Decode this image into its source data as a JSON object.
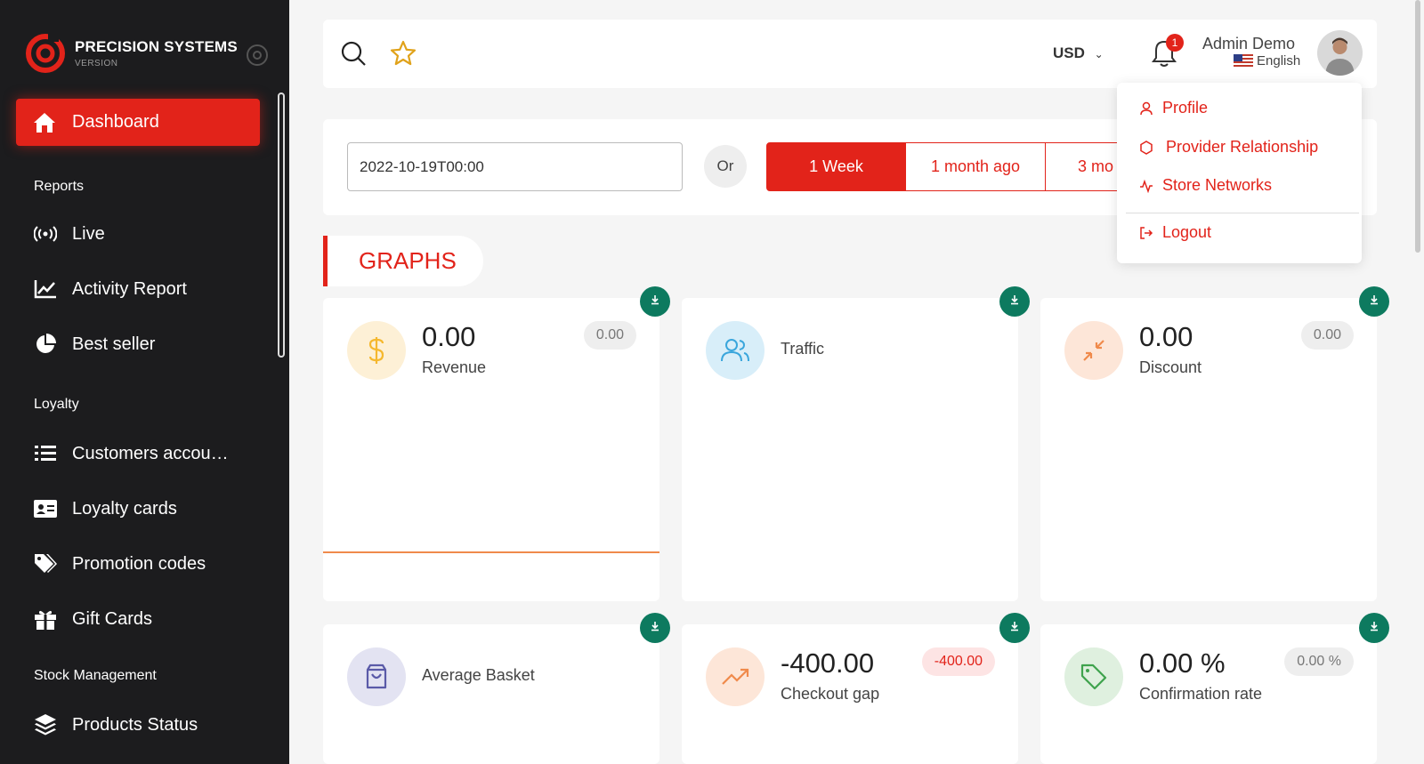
{
  "brand": {
    "name": "PRECISION SYSTEMS",
    "subtitle": "VERSION"
  },
  "sidebar": {
    "active": {
      "label": "Dashboard",
      "icon": "home-icon"
    },
    "sections": [
      {
        "title": "Reports",
        "items": [
          {
            "label": "Live",
            "icon": "broadcast-icon"
          },
          {
            "label": "Activity Report",
            "icon": "line-chart-icon"
          },
          {
            "label": "Best seller",
            "icon": "pie-chart-icon"
          }
        ]
      },
      {
        "title": "Loyalty",
        "items": [
          {
            "label": "Customers accou…",
            "icon": "list-icon"
          },
          {
            "label": "Loyalty cards",
            "icon": "id-card-icon"
          },
          {
            "label": "Promotion codes",
            "icon": "tags-icon"
          },
          {
            "label": "Gift Cards",
            "icon": "gift-icon"
          }
        ]
      },
      {
        "title": "Stock Management",
        "items": [
          {
            "label": "Products Status",
            "icon": "layers-icon"
          }
        ]
      }
    ]
  },
  "topbar": {
    "currency": "USD",
    "notifications_count": "1",
    "user_name": "Admin Demo",
    "language": "English"
  },
  "filter": {
    "date_value": "2022-10-19T00:00",
    "or_label": "Or",
    "ranges": [
      "1 Week",
      "1 month ago",
      "3 mo"
    ],
    "active_range": "1 Week"
  },
  "section_title": "GRAPHS",
  "cards": [
    {
      "value": "0.00",
      "label": "Revenue",
      "badge": "0.00",
      "icon": "dollar-icon",
      "color": "#f5b82e"
    },
    {
      "value": "",
      "label": "Traffic",
      "badge": "",
      "icon": "users-icon",
      "color": "#3aa6dc"
    },
    {
      "value": "0.00",
      "label": "Discount",
      "badge": "0.00",
      "icon": "compress-icon",
      "color": "#f08a4b"
    },
    {
      "value": "",
      "label": "Average Basket",
      "badge": "",
      "icon": "shopping-bag-icon",
      "color": "#5a5aa8"
    },
    {
      "value": "-400.00",
      "label": "Checkout gap",
      "badge": "-400.00",
      "icon": "trending-up-icon",
      "color": "#f08a4b"
    },
    {
      "value": "0.00 %",
      "label": "Confirmation rate",
      "badge": "0.00 %",
      "icon": "tag-icon",
      "color": "#3fa34d"
    }
  ],
  "dropdown": {
    "items": [
      {
        "label": "Profile",
        "icon": "user-icon"
      },
      {
        "label": "Provider Relationship",
        "icon": "hexagon-icon"
      },
      {
        "label": "Store Networks",
        "icon": "activity-icon"
      },
      {
        "label": "Logout",
        "icon": "logout-icon"
      }
    ]
  },
  "colors": {
    "accent": "#e2231a",
    "sidebar_bg": "#1c1c1e",
    "download": "#0d7a5f"
  }
}
